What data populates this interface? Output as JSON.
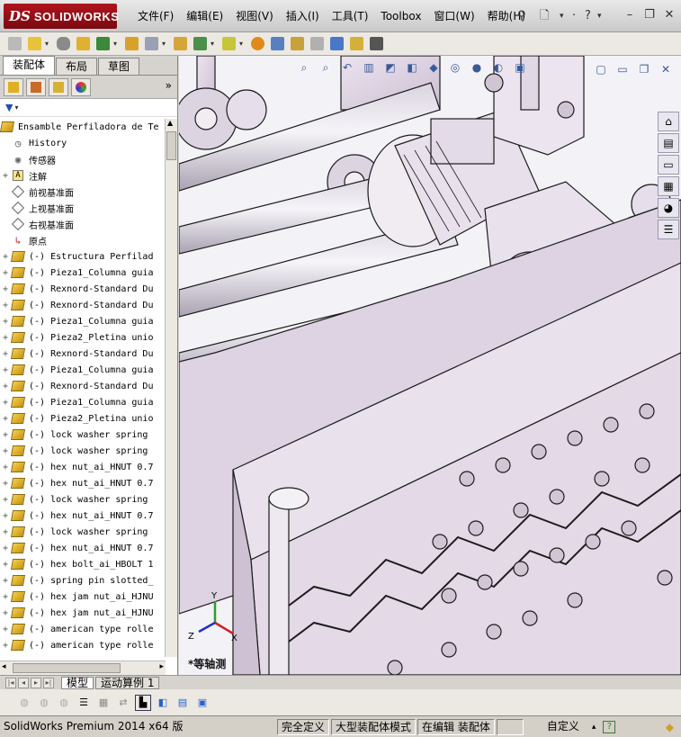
{
  "app": {
    "brand_mark": "DS",
    "brand_name": "SOLIDWORKS"
  },
  "menus": [
    "文件(F)",
    "编辑(E)",
    "视图(V)",
    "插入(I)",
    "工具(T)",
    "Toolbox",
    "窗口(W)",
    "帮助(H)"
  ],
  "left_tabs": [
    "装配体",
    "布局",
    "草图"
  ],
  "tree": {
    "root": "Ensamble Perfiladora de Te",
    "items": [
      {
        "label": "History",
        "icon": "history-icon",
        "expander": ""
      },
      {
        "label": "传感器",
        "icon": "sensor-icon",
        "expander": ""
      },
      {
        "label": "注解",
        "icon": "annotation-icon",
        "expander": "+"
      },
      {
        "label": "前视基准面",
        "icon": "plane-icon",
        "expander": ""
      },
      {
        "label": "上视基准面",
        "icon": "plane-icon",
        "expander": ""
      },
      {
        "label": "右视基准面",
        "icon": "plane-icon",
        "expander": ""
      },
      {
        "label": "原点",
        "icon": "origin-icon",
        "expander": ""
      },
      {
        "label": "(-) Estructura Perfilad",
        "icon": "part-icon",
        "expander": "+"
      },
      {
        "label": "(-) Pieza1_Columna guia",
        "icon": "part-icon",
        "expander": "+"
      },
      {
        "label": "(-) Rexnord-Standard Du",
        "icon": "part-icon",
        "expander": "+"
      },
      {
        "label": "(-) Rexnord-Standard Du",
        "icon": "part-icon",
        "expander": "+"
      },
      {
        "label": "(-) Pieza1_Columna guia",
        "icon": "part-icon",
        "expander": "+"
      },
      {
        "label": "(-) Pieza2_Pletina unio",
        "icon": "part-icon",
        "expander": "+"
      },
      {
        "label": "(-) Rexnord-Standard Du",
        "icon": "part-icon",
        "expander": "+"
      },
      {
        "label": "(-) Pieza1_Columna guia",
        "icon": "part-icon",
        "expander": "+"
      },
      {
        "label": "(-) Rexnord-Standard Du",
        "icon": "part-icon",
        "expander": "+"
      },
      {
        "label": "(-) Pieza1_Columna guia",
        "icon": "part-icon",
        "expander": "+"
      },
      {
        "label": "(-) Pieza2_Pletina unio",
        "icon": "part-icon",
        "expander": "+"
      },
      {
        "label": "(-) lock washer spring",
        "icon": "part-icon",
        "expander": "+"
      },
      {
        "label": "(-) lock washer spring",
        "icon": "part-icon",
        "expander": "+"
      },
      {
        "label": "(-) hex nut_ai_HNUT 0.7",
        "icon": "part-icon",
        "expander": "+"
      },
      {
        "label": "(-) hex nut_ai_HNUT 0.7",
        "icon": "part-icon",
        "expander": "+"
      },
      {
        "label": "(-) lock washer spring",
        "icon": "part-icon",
        "expander": "+"
      },
      {
        "label": "(-) hex nut_ai_HNUT 0.7",
        "icon": "part-icon",
        "expander": "+"
      },
      {
        "label": "(-) lock washer spring",
        "icon": "part-icon",
        "expander": "+"
      },
      {
        "label": "(-) hex nut_ai_HNUT 0.7",
        "icon": "part-icon",
        "expander": "+"
      },
      {
        "label": "(-) hex bolt_ai_HBOLT 1",
        "icon": "part-icon",
        "expander": "+"
      },
      {
        "label": "(-) spring pin slotted_",
        "icon": "part-icon",
        "expander": "+"
      },
      {
        "label": "(-) hex jam nut_ai_HJNU",
        "icon": "part-icon",
        "expander": "+"
      },
      {
        "label": "(-) hex jam nut_ai_HJNU",
        "icon": "part-icon",
        "expander": "+"
      },
      {
        "label": "(-) american type rolle",
        "icon": "part-icon",
        "expander": "+"
      },
      {
        "label": "(-) american type rolle",
        "icon": "part-icon",
        "expander": "+"
      }
    ]
  },
  "viewport": {
    "view_name": "*等轴测",
    "axis_labels": {
      "x": "X",
      "y": "Y",
      "z": "Z"
    }
  },
  "bottom_tabs": [
    "模型",
    "运动算例 1"
  ],
  "status": {
    "product": "SolidWorks Premium 2014 x64 版",
    "definition": "完全定义",
    "mode": "大型装配体模式",
    "editing": "在编辑 装配体",
    "units": "自定义"
  },
  "colors": {
    "part_body": "#e4d9e8",
    "part_edge": "#1c1c1c",
    "shaft": "#ece8ef",
    "viewport_bg": "#f3f2f6",
    "brand": "#a1111a"
  }
}
